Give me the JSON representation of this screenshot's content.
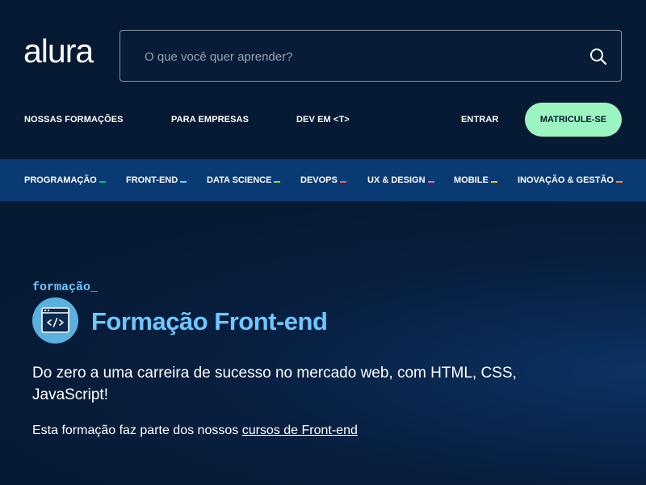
{
  "header": {
    "logo": "alura",
    "search": {
      "placeholder": "O que você quer aprender?",
      "value": ""
    },
    "nav": {
      "formacoes": "NOSSAS FORMAÇÕES",
      "empresas": "PARA EMPRESAS",
      "dev": "DEV EM <T>",
      "entrar": "ENTRAR",
      "matricule": "MATRICULE-SE"
    }
  },
  "categories": [
    {
      "label": "PROGRAMAÇÃO",
      "color": "#00c86f"
    },
    {
      "label": "FRONT-END",
      "color": "#6bd1ff"
    },
    {
      "label": "DATA SCIENCE",
      "color": "#9cd33b"
    },
    {
      "label": "DEVOPS",
      "color": "#f16165"
    },
    {
      "label": "UX & DESIGN",
      "color": "#dc6ebe"
    },
    {
      "label": "MOBILE",
      "color": "#ffba05"
    },
    {
      "label": "INOVAÇÃO & GESTÃO",
      "color": "#ff8c2a"
    }
  ],
  "hero": {
    "eyebrow": "formação_",
    "icon": "code-window-icon",
    "title": "Formação Front-end",
    "description": "Do zero a uma carreira de sucesso no mercado web, com HTML, CSS, JavaScript!",
    "note_prefix": "Esta formação faz parte dos nossos ",
    "note_link": "cursos de Front-end"
  },
  "colors": {
    "background": "#061a33",
    "accent": "#6fc7ff",
    "cta": "#9cf5c0",
    "category_bar": "#0a3a73"
  }
}
